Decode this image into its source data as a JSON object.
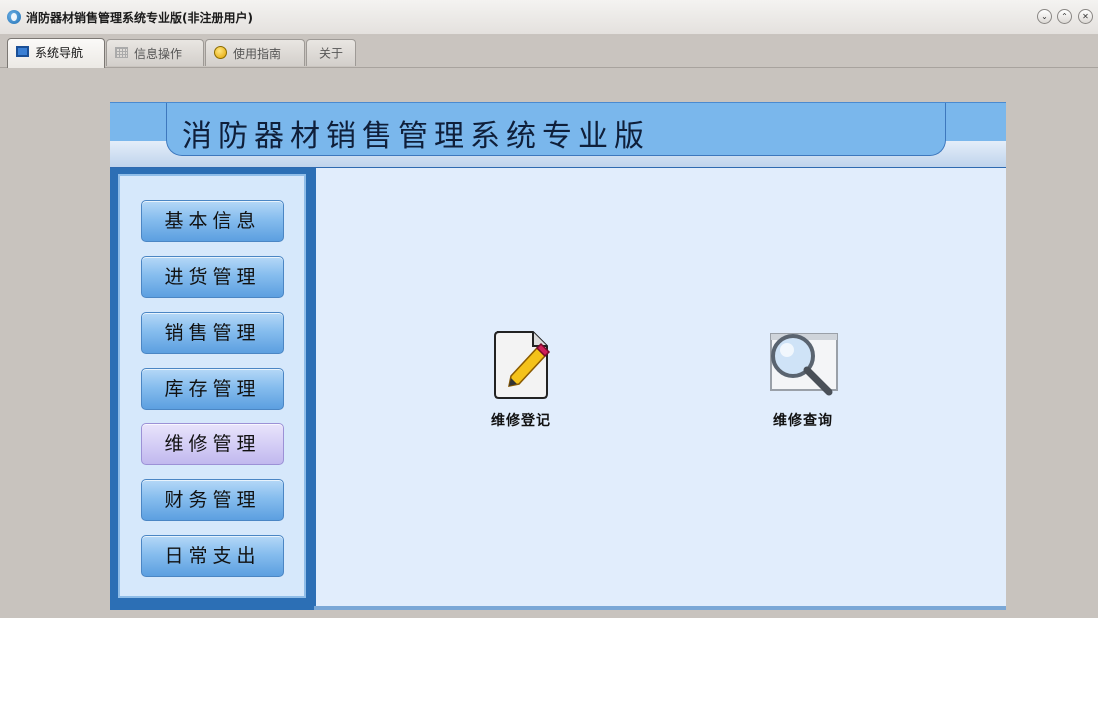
{
  "window": {
    "title": "消防器材销售管理系统专业版(非注册用户)",
    "controls": [
      "minimize",
      "maximize",
      "close"
    ]
  },
  "tabs": [
    {
      "label": "系统导航",
      "icon": "nav-window-icon",
      "active": true
    },
    {
      "label": "信息操作",
      "icon": "grid-icon",
      "active": false
    },
    {
      "label": "使用指南",
      "icon": "guide-icon",
      "active": false
    },
    {
      "label": "关于",
      "icon": "",
      "active": false
    }
  ],
  "header": {
    "title": "消防器材销售管理系统专业版"
  },
  "sidebar": {
    "items": [
      {
        "label": "基本信息",
        "active": false
      },
      {
        "label": "进货管理",
        "active": false
      },
      {
        "label": "销售管理",
        "active": false
      },
      {
        "label": "库存管理",
        "active": false
      },
      {
        "label": "维修管理",
        "active": true
      },
      {
        "label": "财务管理",
        "active": false
      },
      {
        "label": "日常支出",
        "active": false
      }
    ]
  },
  "features": [
    {
      "label": "维修登记",
      "icon": "edit-document-icon"
    },
    {
      "label": "维修查询",
      "icon": "magnifier-icon"
    }
  ],
  "colors": {
    "banner": "#7ab7ec",
    "sidebar_frame": "#2c6fb5",
    "main_bg": "#e1edfc",
    "nav_button": "#86bdee",
    "nav_button_active": "#d3ccf5"
  }
}
